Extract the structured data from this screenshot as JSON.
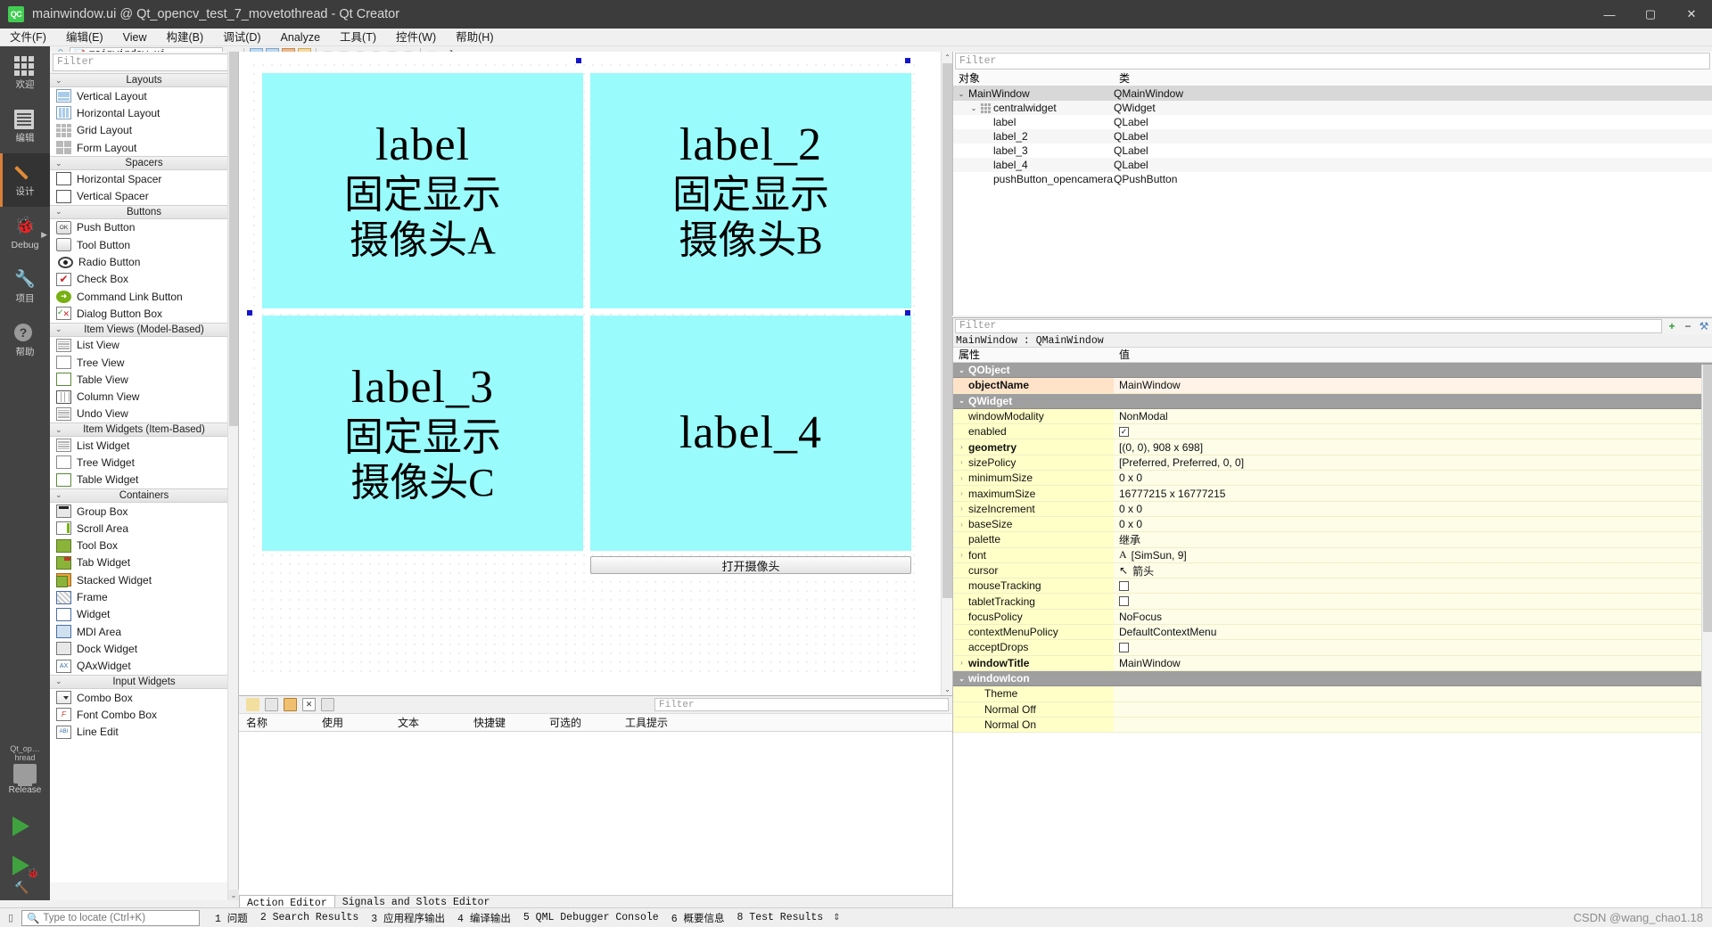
{
  "window": {
    "title": "mainwindow.ui @ Qt_opencv_test_7_movetothread - Qt Creator",
    "logo": "QC",
    "minimize": "—",
    "maximize": "▢",
    "close": "✕"
  },
  "menubar": {
    "items": [
      "文件(F)",
      "编辑(E)",
      "View",
      "构建(B)",
      "调试(D)",
      "Analyze",
      "工具(T)",
      "控件(W)",
      "帮助(H)"
    ]
  },
  "modebar": {
    "modes": [
      {
        "label": "欢迎",
        "icon": "grid-icon"
      },
      {
        "label": "编辑",
        "icon": "document-icon"
      },
      {
        "label": "设计",
        "icon": "pencil-icon"
      },
      {
        "label": "Debug",
        "icon": "bug-icon"
      },
      {
        "label": "项目",
        "icon": "wrench-icon"
      },
      {
        "label": "帮助",
        "icon": "question-icon"
      }
    ],
    "kit": {
      "project": "Qt_op…hread",
      "build": "Release"
    }
  },
  "editor_toolbar": {
    "filename": "mainwindow.ui",
    "caret": "▾",
    "close": "✕"
  },
  "widget_box": {
    "filter_placeholder": "Filter",
    "groups": [
      {
        "title": "Layouts",
        "items": [
          {
            "label": "Vertical Layout",
            "icon": "vertical-layout-icon"
          },
          {
            "label": "Horizontal Layout",
            "icon": "horizontal-layout-icon"
          },
          {
            "label": "Grid Layout",
            "icon": "grid-layout-icon"
          },
          {
            "label": "Form Layout",
            "icon": "form-layout-icon"
          }
        ]
      },
      {
        "title": "Spacers",
        "items": [
          {
            "label": "Horizontal Spacer",
            "icon": "horizontal-spacer-icon"
          },
          {
            "label": "Vertical Spacer",
            "icon": "vertical-spacer-icon"
          }
        ]
      },
      {
        "title": "Buttons",
        "items": [
          {
            "label": "Push Button",
            "icon": "push-button-icon"
          },
          {
            "label": "Tool Button",
            "icon": "tool-button-icon"
          },
          {
            "label": "Radio Button",
            "icon": "radio-button-icon"
          },
          {
            "label": "Check Box",
            "icon": "check-box-icon"
          },
          {
            "label": "Command Link Button",
            "icon": "command-link-icon"
          },
          {
            "label": "Dialog Button Box",
            "icon": "dialog-button-box-icon"
          }
        ]
      },
      {
        "title": "Item Views (Model-Based)",
        "items": [
          {
            "label": "List View",
            "icon": "list-view-icon"
          },
          {
            "label": "Tree View",
            "icon": "tree-view-icon"
          },
          {
            "label": "Table View",
            "icon": "table-view-icon"
          },
          {
            "label": "Column View",
            "icon": "column-view-icon"
          },
          {
            "label": "Undo View",
            "icon": "undo-view-icon"
          }
        ]
      },
      {
        "title": "Item Widgets (Item-Based)",
        "items": [
          {
            "label": "List Widget",
            "icon": "list-widget-icon"
          },
          {
            "label": "Tree Widget",
            "icon": "tree-widget-icon"
          },
          {
            "label": "Table Widget",
            "icon": "table-widget-icon"
          }
        ]
      },
      {
        "title": "Containers",
        "items": [
          {
            "label": "Group Box",
            "icon": "group-box-icon"
          },
          {
            "label": "Scroll Area",
            "icon": "scroll-area-icon"
          },
          {
            "label": "Tool Box",
            "icon": "tool-box-icon"
          },
          {
            "label": "Tab Widget",
            "icon": "tab-widget-icon"
          },
          {
            "label": "Stacked Widget",
            "icon": "stacked-widget-icon"
          },
          {
            "label": "Frame",
            "icon": "frame-icon"
          },
          {
            "label": "Widget",
            "icon": "widget-icon"
          },
          {
            "label": "MDI Area",
            "icon": "mdi-area-icon"
          },
          {
            "label": "Dock Widget",
            "icon": "dock-widget-icon"
          },
          {
            "label": "QAxWidget",
            "icon": "qax-widget-icon"
          }
        ]
      },
      {
        "title": "Input Widgets",
        "items": [
          {
            "label": "Combo Box",
            "icon": "combo-box-icon"
          },
          {
            "label": "Font Combo Box",
            "icon": "font-combo-box-icon"
          },
          {
            "label": "Line Edit",
            "icon": "line-edit-icon"
          }
        ]
      }
    ]
  },
  "canvas": {
    "labels": [
      {
        "name": "label",
        "lines": [
          "label",
          "固定显示",
          "摄像头A"
        ]
      },
      {
        "name": "label_2",
        "lines": [
          "label_2",
          "固定显示",
          "摄像头B"
        ]
      },
      {
        "name": "label_3",
        "lines": [
          "label_3",
          "固定显示",
          "摄像头C"
        ]
      },
      {
        "name": "label_4",
        "lines": [
          "label_4",
          "",
          ""
        ]
      }
    ],
    "button_label": "打开摄像头",
    "label_bg": "#99fbfb",
    "handle_color": "#1414c8"
  },
  "action_editor": {
    "filter_placeholder": "Filter",
    "columns": [
      "名称",
      "使用",
      "文本",
      "快捷键",
      "可选的",
      "工具提示"
    ],
    "tabs": [
      {
        "label": "Action Editor",
        "active": true
      },
      {
        "label": "Signals and Slots Editor",
        "active": false
      }
    ]
  },
  "object_inspector": {
    "filter_placeholder": "Filter",
    "columns": [
      "对象",
      "类"
    ],
    "rows": [
      {
        "object": "MainWindow",
        "class": "QMainWindow",
        "indent": 0,
        "expander": "⌄",
        "selected": true
      },
      {
        "object": "centralwidget",
        "class": "QWidget",
        "indent": 1,
        "expander": "⌄",
        "selected": false
      },
      {
        "object": "label",
        "class": "QLabel",
        "indent": 2,
        "expander": "",
        "selected": false
      },
      {
        "object": "label_2",
        "class": "QLabel",
        "indent": 2,
        "expander": "",
        "selected": false
      },
      {
        "object": "label_3",
        "class": "QLabel",
        "indent": 2,
        "expander": "",
        "selected": false
      },
      {
        "object": "label_4",
        "class": "QLabel",
        "indent": 2,
        "expander": "",
        "selected": false
      },
      {
        "object": "pushButton_opencamera",
        "class": "QPushButton",
        "indent": 2,
        "expander": "",
        "selected": false
      }
    ]
  },
  "property_editor": {
    "filter_placeholder": "Filter",
    "add_button": "+",
    "remove_button": "−",
    "config_button": "⚒",
    "object_line": "MainWindow : QMainWindow",
    "columns": [
      "属性",
      "值"
    ],
    "rows": [
      {
        "kind": "group",
        "name": "QObject",
        "value": ""
      },
      {
        "kind": "prop",
        "name": "objectName",
        "value": "MainWindow",
        "highlight": true,
        "bold": true
      },
      {
        "kind": "group",
        "name": "QWidget",
        "value": ""
      },
      {
        "kind": "prop",
        "name": "windowModality",
        "value": "NonModal"
      },
      {
        "kind": "check",
        "name": "enabled",
        "value": "✓",
        "checked": true
      },
      {
        "kind": "expand",
        "name": "geometry",
        "value": "[(0, 0), 908 x 698]",
        "bold": true
      },
      {
        "kind": "expand",
        "name": "sizePolicy",
        "value": "[Preferred, Preferred, 0, 0]"
      },
      {
        "kind": "expand",
        "name": "minimumSize",
        "value": "0 x 0"
      },
      {
        "kind": "expand",
        "name": "maximumSize",
        "value": "16777215 x 16777215"
      },
      {
        "kind": "expand",
        "name": "sizeIncrement",
        "value": "0 x 0"
      },
      {
        "kind": "expand",
        "name": "baseSize",
        "value": "0 x 0"
      },
      {
        "kind": "prop",
        "name": "palette",
        "value": "继承"
      },
      {
        "kind": "font",
        "name": "font",
        "value": "[SimSun, 9]"
      },
      {
        "kind": "cursor",
        "name": "cursor",
        "value": "箭头"
      },
      {
        "kind": "check",
        "name": "mouseTracking",
        "value": "",
        "checked": false
      },
      {
        "kind": "check",
        "name": "tabletTracking",
        "value": "",
        "checked": false
      },
      {
        "kind": "prop",
        "name": "focusPolicy",
        "value": "NoFocus"
      },
      {
        "kind": "prop",
        "name": "contextMenuPolicy",
        "value": "DefaultContextMenu"
      },
      {
        "kind": "check",
        "name": "acceptDrops",
        "value": "",
        "checked": false
      },
      {
        "kind": "expand",
        "name": "windowTitle",
        "value": "MainWindow",
        "bold": true
      },
      {
        "kind": "group2",
        "name": "windowIcon",
        "value": ""
      },
      {
        "kind": "sub",
        "name": "Theme",
        "value": ""
      },
      {
        "kind": "sub",
        "name": "Normal Off",
        "value": ""
      },
      {
        "kind": "sub",
        "name": "Normal On",
        "value": ""
      }
    ]
  },
  "statusbar": {
    "locator_placeholder": "Type to locate (Ctrl+K)",
    "items": [
      "1 问题",
      "2 Search Results",
      "3 应用程序输出",
      "4 编译输出",
      "5 QML Debugger Console",
      "6 概要信息",
      "8 Test Results"
    ],
    "arrows": "⇕",
    "watermark": "CSDN @wang_chao1.18"
  }
}
